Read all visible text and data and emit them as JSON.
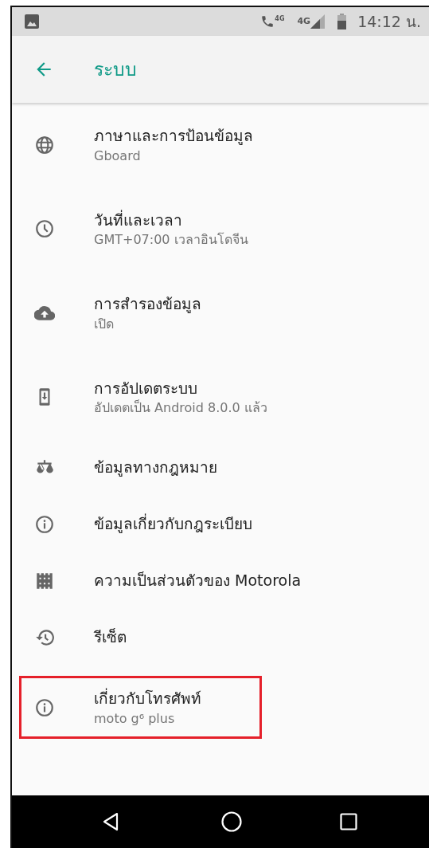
{
  "status_bar": {
    "call_label": "4G",
    "network": "4G",
    "time": "14:12 น."
  },
  "toolbar": {
    "title": "ระบบ"
  },
  "items": [
    {
      "title": "ภาษาและการป้อนข้อมูล",
      "subtitle": "Gboard",
      "highlighted": false
    },
    {
      "title": "วันที่และเวลา",
      "subtitle": "GMT+07:00 เวลาอินโดจีน",
      "highlighted": false
    },
    {
      "title": "การสำรองข้อมูล",
      "subtitle": "เปิด",
      "highlighted": false
    },
    {
      "title": "การอัปเดตระบบ",
      "subtitle": "อัปเดตเป็น Android 8.0.0 แล้ว",
      "highlighted": false
    },
    {
      "title": "ข้อมูลทางกฎหมาย",
      "highlighted": false
    },
    {
      "title": "ข้อมูลเกี่ยวกับกฎระเบียบ",
      "highlighted": false
    },
    {
      "title": "ความเป็นส่วนตัวของ Motorola",
      "highlighted": false
    },
    {
      "title": "รีเซ็ต",
      "highlighted": false
    },
    {
      "title": "เกี่ยวกับโทรศัพท์",
      "subtitle": "moto g⁶ plus",
      "highlighted": true
    }
  ]
}
